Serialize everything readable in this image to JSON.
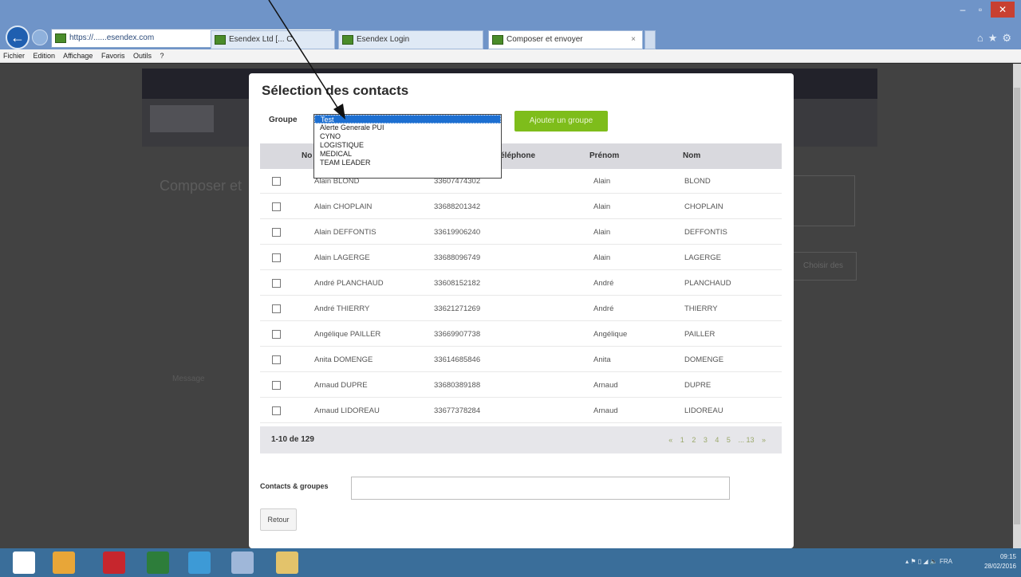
{
  "browser": {
    "url_prefix": "https",
    "url_domain": "esendex.com",
    "tab1_label": "Esendex Ltd [... C",
    "tab2_label": "Esendex Login",
    "tab3_label": "Composer et envoyer",
    "tab_close": "×"
  },
  "menu": {
    "items": [
      "Fichier",
      "Edition",
      "Affichage",
      "Favoris",
      "Outils",
      "?"
    ]
  },
  "modal": {
    "title": "Sélection des contacts",
    "group_label": "Groupe",
    "add_group_button": "Ajouter un groupe",
    "columns": [
      "No",
      "Téléphone",
      "Prénom",
      "Nom"
    ],
    "rows": [
      {
        "name": "Alain BLOND",
        "phone": "33607474302",
        "first": "Alain",
        "last": "BLOND"
      },
      {
        "name": "Alain CHOPLAIN",
        "phone": "33688201342",
        "first": "Alain",
        "last": "CHOPLAIN"
      },
      {
        "name": "Alain DEFFONTIS",
        "phone": "33619906240",
        "first": "Alain",
        "last": "DEFFONTIS"
      },
      {
        "name": "Alain LAGERGE",
        "phone": "33688096749",
        "first": "Alain",
        "last": "LAGERGE"
      },
      {
        "name": "André PLANCHAUD",
        "phone": "33608152182",
        "first": "André",
        "last": "PLANCHAUD"
      },
      {
        "name": "André THIERRY",
        "phone": "33621271269",
        "first": "André",
        "last": "THIERRY"
      },
      {
        "name": "Angélique PAILLER",
        "phone": "33669907738",
        "first": "Angélique",
        "last": "PAILLER"
      },
      {
        "name": "Anita DOMENGE",
        "phone": "33614685846",
        "first": "Anita",
        "last": "DOMENGE"
      },
      {
        "name": "Arnaud DUPRE",
        "phone": "33680389188",
        "first": "Arnaud",
        "last": "DUPRE"
      },
      {
        "name": "Arnaud LIDOREAU",
        "phone": "33677378284",
        "first": "Arnaud",
        "last": "LIDOREAU"
      }
    ],
    "pager_range": "1-10 de 129",
    "pager_pages": [
      "«",
      "1",
      "2",
      "3",
      "4",
      "5",
      "... 13",
      "»"
    ],
    "contacts_groups_label": "Contacts & groupes",
    "back_button": "Retour"
  },
  "dropdown": {
    "options": [
      "Test",
      "Alerte Generale PUI",
      "CYNO",
      "LOGISTIQUE",
      "MEDICAL",
      "TEAM LEADER"
    ],
    "selected_index": 0
  },
  "background_page": {
    "heading": "Composer et",
    "side_button": "Choisir des",
    "message_label": "Message"
  },
  "taskbar": {
    "language": "FRA",
    "time": "09:15",
    "date": "28/02/2016"
  },
  "colors": {
    "accent_green": "#7ebd1b",
    "select_blue": "#1d6fd1",
    "taskbar": "#3a6e9a"
  }
}
